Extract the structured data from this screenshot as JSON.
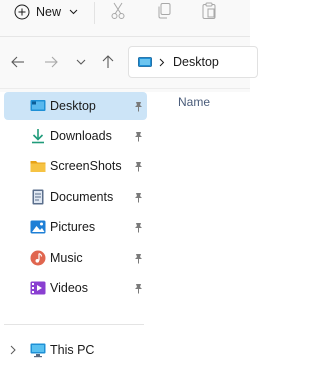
{
  "toolbar": {
    "new_label": "New",
    "icons": [
      "new-plus-icon",
      "dropdown-chevron-icon",
      "cut-icon",
      "copy-icon",
      "paste-icon"
    ]
  },
  "navigation": {
    "back_icon": "back-arrow-icon",
    "forward_icon": "forward-arrow-icon",
    "recent_icon": "recent-locations-chevron-icon",
    "up_icon": "up-arrow-icon"
  },
  "address_bar": {
    "icon": "this-pc-icon",
    "crumb": "Desktop"
  },
  "sidebar": {
    "items": [
      {
        "label": "Desktop",
        "icon": "desktop-folder-icon",
        "pinned": true,
        "selected": true
      },
      {
        "label": "Downloads",
        "icon": "downloads-icon",
        "pinned": true
      },
      {
        "label": "ScreenShots",
        "icon": "folder-icon",
        "pinned": true
      },
      {
        "label": "Documents",
        "icon": "documents-icon",
        "pinned": true
      },
      {
        "label": "Pictures",
        "icon": "pictures-icon",
        "pinned": true
      },
      {
        "label": "Music",
        "icon": "music-icon",
        "pinned": true
      },
      {
        "label": "Videos",
        "icon": "videos-icon",
        "pinned": true
      }
    ],
    "this_pc": {
      "label": "This PC",
      "icon": "this-pc-icon"
    }
  },
  "content": {
    "column_header": "Name"
  },
  "colors": {
    "selected_bg": "#cce4f7",
    "accent": "#0067c0"
  }
}
